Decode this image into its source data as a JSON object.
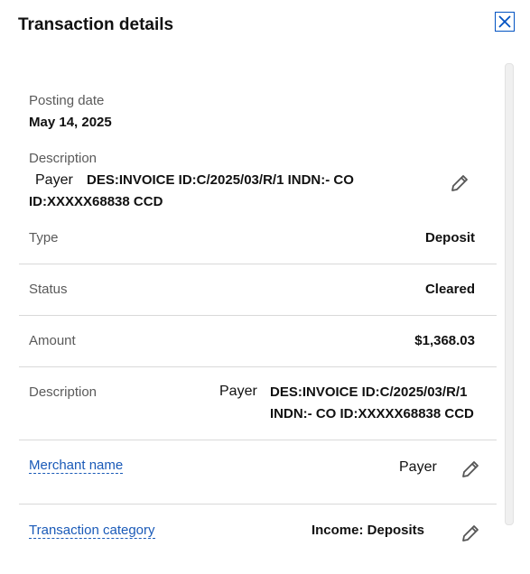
{
  "header": {
    "title": "Transaction details"
  },
  "icons": {
    "close": "close-icon",
    "edit": "pencil-icon"
  },
  "top": {
    "posting_date_label": "Posting date",
    "posting_date_value": "May 14, 2025",
    "description_label": "Description",
    "description_payer": "Payer",
    "description_line1": "DES:INVOICE ID:C/2025/03/R/1 INDN:- CO",
    "description_line2": "ID:XXXXX68838 CCD"
  },
  "rows": {
    "type_label": "Type",
    "type_value": "Deposit",
    "status_label": "Status",
    "status_value": "Cleared",
    "amount_label": "Amount",
    "amount_value": "$1,368.03",
    "description_label": "Description",
    "description_payer": "Payer",
    "description_line1": "DES:INVOICE ID:C/2025/03/R/1",
    "description_line2": "INDN:- CO ID:XXXXX68838 CCD",
    "merchant_label": "Merchant name",
    "merchant_value": "Payer",
    "category_label": "Transaction category",
    "category_value": "Income: Deposits"
  },
  "colors": {
    "link": "#1a5ab8",
    "close_border": "#0052c2",
    "divider": "#d9d9d9"
  }
}
